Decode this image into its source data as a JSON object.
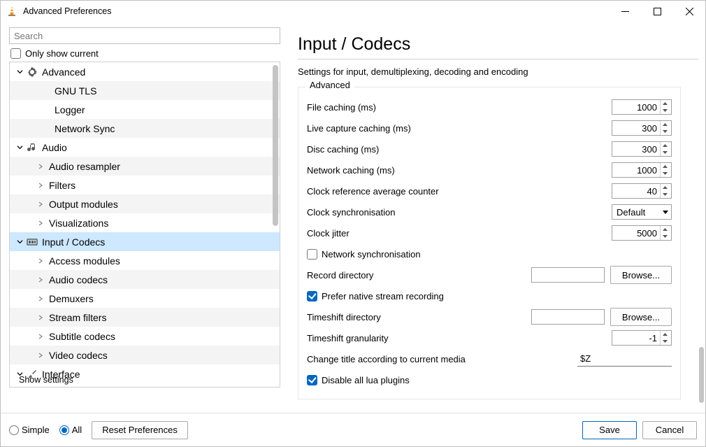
{
  "window": {
    "title": "Advanced Preferences"
  },
  "search": {
    "placeholder": "Search"
  },
  "only_show_current": {
    "label": "Only show current",
    "checked": false
  },
  "tree": {
    "advanced": {
      "label": "Advanced"
    },
    "gnu_tls": {
      "label": "GNU TLS"
    },
    "logger": {
      "label": "Logger"
    },
    "network_sync": {
      "label": "Network Sync"
    },
    "audio": {
      "label": "Audio"
    },
    "resampler": {
      "label": "Audio resampler"
    },
    "filters": {
      "label": "Filters"
    },
    "output_mod": {
      "label": "Output modules"
    },
    "visual": {
      "label": "Visualizations"
    },
    "input_codecs": {
      "label": "Input / Codecs"
    },
    "access_mod": {
      "label": "Access modules"
    },
    "audio_codecs": {
      "label": "Audio codecs"
    },
    "demuxers": {
      "label": "Demuxers"
    },
    "stream_filters": {
      "label": "Stream filters"
    },
    "subtitle_codecs": {
      "label": "Subtitle codecs"
    },
    "video_codecs": {
      "label": "Video codecs"
    },
    "interface": {
      "label": "Interface"
    }
  },
  "page": {
    "title": "Input / Codecs",
    "subtitle": "Settings for input, demultiplexing, decoding and encoding",
    "group_advanced": "Advanced",
    "file_caching": {
      "label": "File caching (ms)",
      "value": "1000"
    },
    "live_caching": {
      "label": "Live capture caching (ms)",
      "value": "300"
    },
    "disc_caching": {
      "label": "Disc caching (ms)",
      "value": "300"
    },
    "net_caching": {
      "label": "Network caching (ms)",
      "value": "1000"
    },
    "clock_ref": {
      "label": "Clock reference average counter",
      "value": "40"
    },
    "clock_sync": {
      "label": "Clock synchronisation",
      "value": "Default"
    },
    "clock_jitter": {
      "label": "Clock jitter",
      "value": "5000"
    },
    "net_sync": {
      "label": "Network synchronisation",
      "checked": false
    },
    "record_dir": {
      "label": "Record directory",
      "value": "",
      "browse": "Browse..."
    },
    "prefer_native": {
      "label": "Prefer native stream recording",
      "checked": true
    },
    "timeshift_dir": {
      "label": "Timeshift directory",
      "value": "",
      "browse": "Browse..."
    },
    "timeshift_gran": {
      "label": "Timeshift granularity",
      "value": "-1"
    },
    "change_title": {
      "label": "Change title according to current media",
      "value": "$Z"
    },
    "disable_lua": {
      "label": "Disable all lua plugins",
      "checked": true
    }
  },
  "footer": {
    "show_settings": "Show settings",
    "simple": "Simple",
    "all": "All",
    "mode": "all",
    "reset": "Reset Preferences",
    "save": "Save",
    "cancel": "Cancel"
  }
}
